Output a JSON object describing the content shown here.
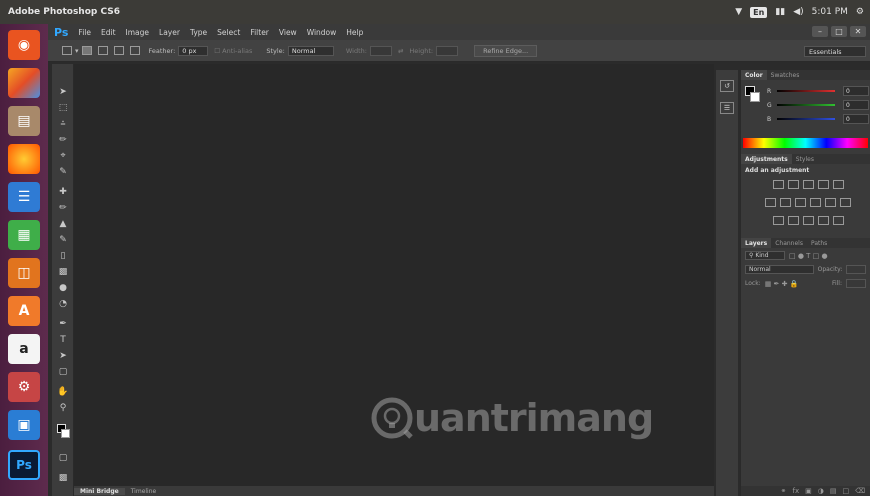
{
  "window": {
    "title": "Adobe Photoshop CS6"
  },
  "tray": {
    "keyboard": "En",
    "time": "5:01 PM"
  },
  "launcher": {
    "items": [
      {
        "name": "ubuntu-dash",
        "color": "#e95420"
      },
      {
        "name": "software-center",
        "color": "#f5a623"
      },
      {
        "name": "files",
        "color": "#9c7c5a"
      },
      {
        "name": "firefox",
        "color": "#ff7a1a"
      },
      {
        "name": "libreoffice-writer",
        "color": "#2f7bd4"
      },
      {
        "name": "libreoffice-calc",
        "color": "#3fae49"
      },
      {
        "name": "libreoffice-impress",
        "color": "#e1741e"
      },
      {
        "name": "ubuntu-software",
        "color": "#f07a2a"
      },
      {
        "name": "amazon",
        "color": "#ffffff"
      },
      {
        "name": "system-settings",
        "color": "#c64545"
      },
      {
        "name": "app",
        "color": "#2a7dd4"
      },
      {
        "name": "photoshop",
        "color": "#0a1a33"
      }
    ],
    "amazon_letter": "a",
    "ps_label": "Ps"
  },
  "menubar": {
    "logo": "Ps",
    "items": [
      "File",
      "Edit",
      "Image",
      "Layer",
      "Type",
      "Select",
      "Filter",
      "View",
      "Window",
      "Help"
    ]
  },
  "options": {
    "feather_label": "Feather:",
    "feather_value": "0 px",
    "antialias_label": "Anti-alias",
    "style_label": "Style:",
    "style_value": "Normal",
    "width_label": "Width:",
    "height_label": "Height:",
    "refine_label": "Refine Edge...",
    "workspace": "Essentials"
  },
  "panels": {
    "color_tabs": [
      "Color",
      "Swatches"
    ],
    "sliders": [
      {
        "letter": "R",
        "value": "0",
        "color": "#e03030"
      },
      {
        "letter": "G",
        "value": "0",
        "color": "#30c030"
      },
      {
        "letter": "B",
        "value": "0",
        "color": "#3050e0"
      }
    ],
    "adjust_tabs": [
      "Adjustments",
      "Styles"
    ],
    "add_adjustment": "Add an adjustment",
    "layers_tabs": [
      "Layers",
      "Channels",
      "Paths"
    ],
    "kind_label": "Kind",
    "blend_mode": "Normal",
    "opacity_label": "Opacity:",
    "lock_label": "Lock:",
    "fill_label": "Fill:"
  },
  "bottom": {
    "tabs": [
      "Mini Bridge",
      "Timeline"
    ]
  },
  "watermark": {
    "text": "uantrimang"
  }
}
